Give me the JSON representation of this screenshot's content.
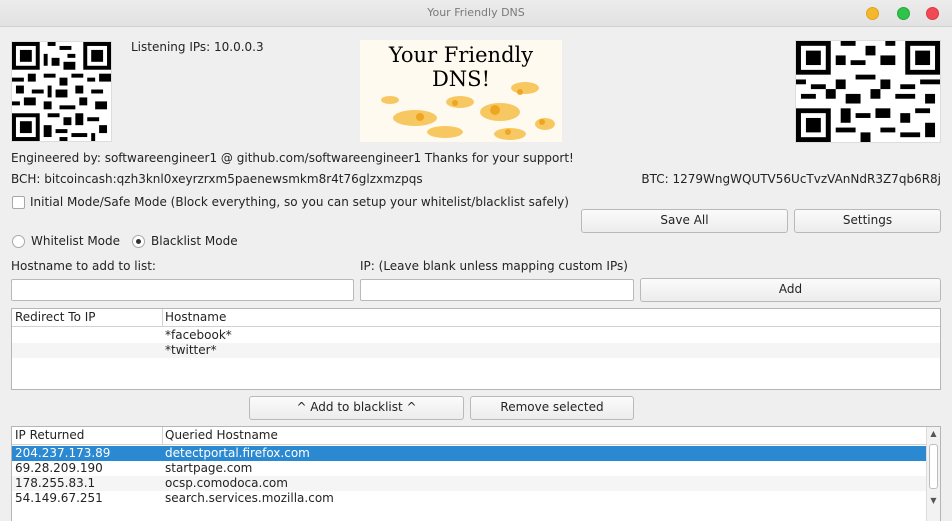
{
  "window": {
    "title": "Your Friendly DNS"
  },
  "header": {
    "listening_ips": "Listening IPs: 10.0.0.3",
    "banner_text": "Your Friendly DNS!",
    "engineered_by": "Engineered by: softwareengineer1 @ github.com/softwareengineer1 Thanks for your support!",
    "bch": "BCH: bitcoincash:qzh3knl0xeyrzrxm5paenewsmkm8r4t76glzxmzpqs",
    "btc": "BTC: 1279WngWQUTV56UcTvzVAnNdR3Z7qb6R8j"
  },
  "options": {
    "initial_mode_label": "Initial Mode/Safe Mode (Block everything, so you can setup your whitelist/blacklist safely)",
    "initial_mode_checked": false,
    "whitelist_label": "Whitelist Mode",
    "blacklist_label": "Blacklist Mode",
    "selected_mode": "Blacklist Mode"
  },
  "buttons": {
    "save_all": "Save All",
    "settings": "Settings",
    "add": "Add",
    "add_to_blacklist": "^ Add to blacklist ^",
    "remove_selected": "Remove selected"
  },
  "form": {
    "hostname_label": "Hostname to add to list:",
    "ip_label": "IP: (Leave blank unless mapping custom IPs)",
    "hostname_value": "",
    "ip_value": ""
  },
  "list_table": {
    "columns": [
      "Redirect To IP",
      "Hostname"
    ],
    "rows": [
      {
        "ip": "",
        "hostname": "*facebook*"
      },
      {
        "ip": "",
        "hostname": "*twitter*"
      }
    ]
  },
  "query_table": {
    "columns": [
      "IP Returned",
      "Queried Hostname"
    ],
    "rows": [
      {
        "ip": "204.237.173.89",
        "hostname": "detectportal.firefox.com",
        "selected": true
      },
      {
        "ip": "69.28.209.190",
        "hostname": "startpage.com",
        "selected": false
      },
      {
        "ip": "178.255.83.1",
        "hostname": "ocsp.comodoca.com",
        "selected": false
      },
      {
        "ip": "54.149.67.251",
        "hostname": "search.services.mozilla.com",
        "selected": false
      }
    ]
  },
  "colors": {
    "selection": "#2b89d1",
    "window_bg": "#efefef",
    "btn_close": "#f24a55",
    "btn_min": "#f3b82d",
    "btn_max": "#30c34c"
  }
}
